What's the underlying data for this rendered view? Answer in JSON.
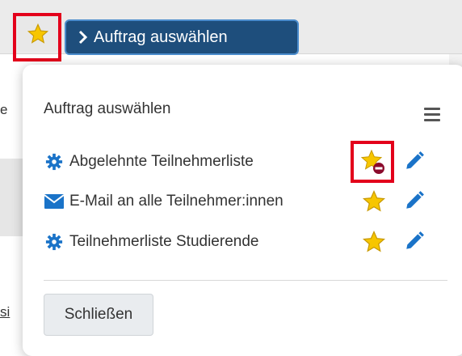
{
  "background": {
    "fragment_e": "e",
    "fragment_si": "si"
  },
  "toolbar": {
    "favorite_icon": "star-icon",
    "select_button_label": "Auftrag auswählen"
  },
  "popup": {
    "title": "Auftrag auswählen",
    "menu_icon": "hamburger-menu-icon",
    "items": [
      {
        "label": "Abgelehnte Teilnehmerliste",
        "icon": "gear-icon",
        "favorite_state": "remove",
        "action_icon": "pencil-icon"
      },
      {
        "label": "E-Mail an alle Teilnehmer:innen",
        "icon": "envelope-icon",
        "favorite_state": "favorite",
        "action_icon": "pencil-icon"
      },
      {
        "label": "Teilnehmerliste Studierende",
        "icon": "gear-icon",
        "favorite_state": "favorite",
        "action_icon": "pencil-icon"
      }
    ],
    "close_label": "Schließen"
  },
  "colors": {
    "primary": "#1e4e7c",
    "star": "#f7c600",
    "icon_blue": "#1a73c8",
    "remove_badge": "#8b0a2c",
    "highlight": "#e3001b"
  }
}
